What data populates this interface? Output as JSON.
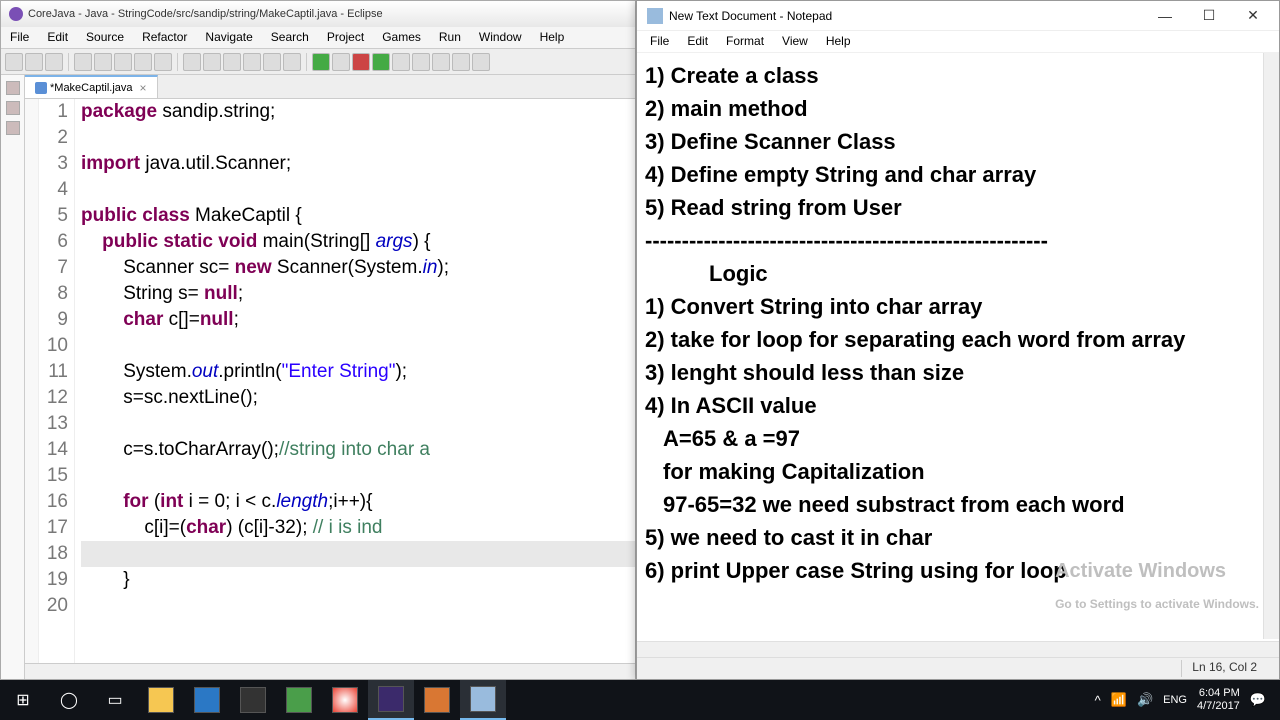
{
  "eclipse": {
    "title": "CoreJava - Java - StringCode/src/sandip/string/MakeCaptil.java - Eclipse",
    "menu": [
      "File",
      "Edit",
      "Source",
      "Refactor",
      "Navigate",
      "Search",
      "Project",
      "Games",
      "Run",
      "Window",
      "Help"
    ],
    "tab": "*MakeCaptil.java",
    "tab_close": "×",
    "lines": [
      {
        "n": "1",
        "indent": 0,
        "tokens": [
          {
            "t": "package ",
            "c": "kw"
          },
          {
            "t": "sandip.string;"
          }
        ]
      },
      {
        "n": "2",
        "indent": 0,
        "tokens": []
      },
      {
        "n": "3",
        "indent": 0,
        "tokens": [
          {
            "t": "import ",
            "c": "kw"
          },
          {
            "t": "java.util.Scanner;"
          }
        ]
      },
      {
        "n": "4",
        "indent": 0,
        "tokens": []
      },
      {
        "n": "5",
        "indent": 0,
        "tokens": [
          {
            "t": "public class ",
            "c": "kw"
          },
          {
            "t": "MakeCaptil {"
          }
        ]
      },
      {
        "n": "6",
        "indent": 1,
        "tokens": [
          {
            "t": "public static void ",
            "c": "kw"
          },
          {
            "t": "main(String[] "
          },
          {
            "t": "args",
            "c": "field"
          },
          {
            "t": ") {"
          }
        ]
      },
      {
        "n": "7",
        "indent": 2,
        "tokens": [
          {
            "t": "Scanner sc= "
          },
          {
            "t": "new ",
            "c": "kw"
          },
          {
            "t": "Scanner(System."
          },
          {
            "t": "in",
            "c": "field"
          },
          {
            "t": ");"
          }
        ]
      },
      {
        "n": "8",
        "indent": 2,
        "tokens": [
          {
            "t": "String s= "
          },
          {
            "t": "null",
            "c": "kw"
          },
          {
            "t": ";"
          }
        ]
      },
      {
        "n": "9",
        "indent": 2,
        "tokens": [
          {
            "t": "char ",
            "c": "kw"
          },
          {
            "t": "c[]="
          },
          {
            "t": "null",
            "c": "kw"
          },
          {
            "t": ";"
          }
        ]
      },
      {
        "n": "10",
        "indent": 2,
        "tokens": []
      },
      {
        "n": "11",
        "indent": 2,
        "tokens": [
          {
            "t": "System."
          },
          {
            "t": "out",
            "c": "field"
          },
          {
            "t": ".println("
          },
          {
            "t": "\"Enter String\"",
            "c": "str"
          },
          {
            "t": ");"
          }
        ]
      },
      {
        "n": "12",
        "indent": 2,
        "tokens": [
          {
            "t": "s=sc.nextLine();"
          }
        ]
      },
      {
        "n": "13",
        "indent": 2,
        "tokens": []
      },
      {
        "n": "14",
        "indent": 2,
        "tokens": [
          {
            "t": "c=s.toCharArray();"
          },
          {
            "t": "//string into char a",
            "c": "cm"
          }
        ]
      },
      {
        "n": "15",
        "indent": 2,
        "tokens": []
      },
      {
        "n": "16",
        "indent": 2,
        "tokens": [
          {
            "t": "for ",
            "c": "kw"
          },
          {
            "t": "("
          },
          {
            "t": "int ",
            "c": "kw"
          },
          {
            "t": "i = 0; i < c."
          },
          {
            "t": "length",
            "c": "field"
          },
          {
            "t": ";i++){"
          }
        ]
      },
      {
        "n": "17",
        "indent": 3,
        "tokens": [
          {
            "t": "c[i]=("
          },
          {
            "t": "char",
            "c": "kw"
          },
          {
            "t": ") (c[i]-32); "
          },
          {
            "t": "// i is ind",
            "c": "cm"
          }
        ]
      },
      {
        "n": "18",
        "indent": 3,
        "tokens": [],
        "hl": true
      },
      {
        "n": "19",
        "indent": 2,
        "tokens": [
          {
            "t": "}"
          }
        ]
      },
      {
        "n": "20",
        "indent": 2,
        "tokens": []
      }
    ]
  },
  "notepad": {
    "title": "New Text Document - Notepad",
    "menu": [
      "File",
      "Edit",
      "Format",
      "View",
      "Help"
    ],
    "minimize": "—",
    "maximize": "☐",
    "close": "✕",
    "content": [
      {
        "t": "1) Create a class"
      },
      {
        "t": "2) main method"
      },
      {
        "t": "3) Define Scanner Class"
      },
      {
        "t": "4) Define empty String and char array"
      },
      {
        "t": "5) Read string from User"
      },
      {
        "t": "-------------------------------------------------------"
      },
      {
        "t": "Logic",
        "cls": "logic"
      },
      {
        "t": "1) Convert String into char array"
      },
      {
        "t": "2) take for loop for separating each word from array"
      },
      {
        "t": "3) lenght should less than size"
      },
      {
        "t": "4) In ASCII value"
      },
      {
        "t": "A=65 & a =97",
        "cls": "sub"
      },
      {
        "t": "for making Capitalization",
        "cls": "sub"
      },
      {
        "t": "97-65=32 we need substract from each word",
        "cls": "sub"
      },
      {
        "t": "5) we need to cast it in char"
      },
      {
        "t": "6) print Upper case String using for loop"
      }
    ],
    "status": "Ln 16, Col 2",
    "watermark1": "Activate Windows",
    "watermark2": "Go to Settings to activate Windows."
  },
  "taskbar": {
    "tray": {
      "up": "^",
      "net": "🔊",
      "wifi": "📶",
      "lang": "ENG",
      "time": "6:04 PM",
      "date": "4/7/2017",
      "notif": "💬"
    }
  }
}
